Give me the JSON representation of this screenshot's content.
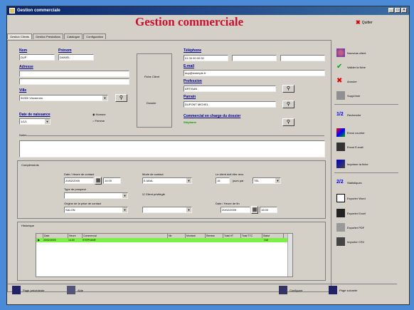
{
  "window": {
    "title": "Gestion commerciale"
  },
  "header": {
    "title": "Gestion commerciale",
    "quit_label": "Quitter"
  },
  "tabs": [
    "Gestion Clients",
    "Gestion Prestations",
    "Catalogue",
    "Configuration"
  ],
  "form": {
    "nom_label": "Nom",
    "nom_value": "DUP",
    "prenom_label": "Prénom",
    "prenom_value": "DANIEL",
    "adresse_label": "Adresse",
    "ville_label": "Ville",
    "ville_value": "94300 Vincennes",
    "date_label": "Date de naissance",
    "date_value": "1/1/1",
    "gender_options": [
      "Homme",
      "Femme"
    ],
    "fiche_label": "Fiche Client",
    "dossier_label": "Dossier",
    "telephone_label": "Téléphone",
    "telephone_value": "01 00 00 00 00",
    "email_label": "E-mail",
    "email_value": "dup@exemple.fr",
    "profession_label": "Profession",
    "profession_value": "ARTISAN",
    "parrain_label": "Parrain",
    "parrain_value": "DUPONT MICHEL",
    "commercial_label": "Commercial en charge du dossier",
    "commercial_value": "Stéphane",
    "notes_label": "Notes"
  },
  "complement": {
    "title": "Compléments",
    "date_contact_label": "Date / Heure de contact",
    "date_contact_value": "20/02/2009",
    "heure_contact_value": "14:00",
    "mode_contact_label": "Mode de contact",
    "mode_contact_value": "E-MAIL",
    "rdv_label": "Le client doit être revu",
    "rdv_value": "15",
    "rdv_unit": "jours par",
    "rdv_mode": "TEL",
    "type_label": "Type de prospect",
    "checkbox_label": "Client privilégié",
    "origine_label": "Origine de la prise de contact",
    "origine_value": "SALON",
    "date_fin_label": "Date / Heure de fin",
    "date_fin_value": "20/02/2009",
    "heure_fin_value": "15:00"
  },
  "history": {
    "title": "Historique",
    "columns": [
      "Date",
      "Heure",
      "Commercial",
      "Nb",
      "Montant",
      "Remise",
      "Total HT",
      "Total TTC",
      "Statut"
    ],
    "row": [
      "20/02/2009",
      "14:00",
      "STEPHANE",
      "",
      "",
      "",
      "",
      "",
      "OUI"
    ]
  },
  "sidebar": {
    "items": [
      "Nouveau client",
      "Valider la fiche",
      "Annuler",
      "Supprimer",
      "Recherche",
      "Envoi courrier",
      "Envoi E-mail",
      "Imprimer la fiche",
      "Statistiques",
      "Exporter Word",
      "Exporter Excel",
      "Exporter PDF",
      "Importer CSV"
    ]
  },
  "status": {
    "left": "Page précédente",
    "middle1": "Aide",
    "middle2": "Configurer",
    "right": "Page suivante"
  }
}
